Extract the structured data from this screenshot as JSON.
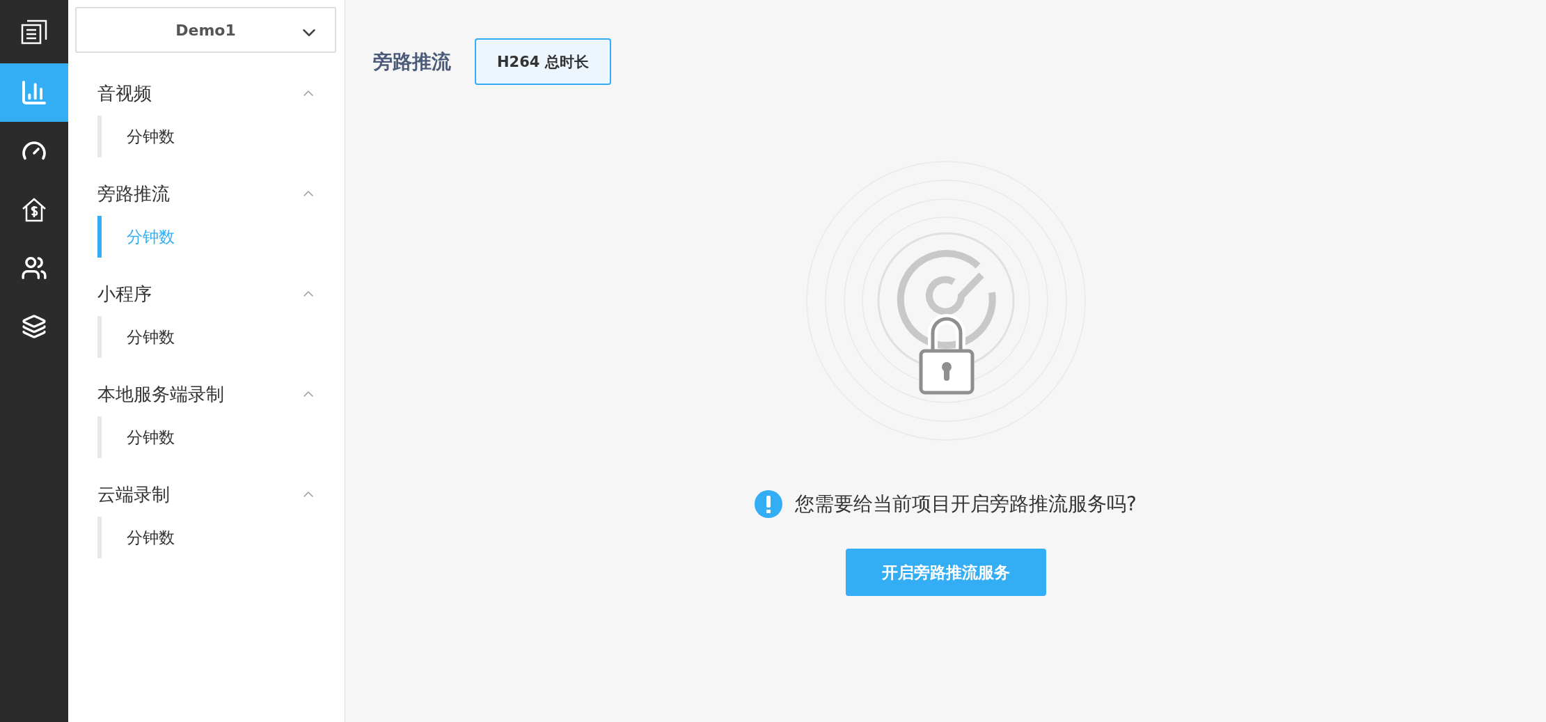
{
  "rail": [
    {
      "kind": "docs",
      "selected": false
    },
    {
      "kind": "chart",
      "selected": true
    },
    {
      "kind": "gauge",
      "selected": false
    },
    {
      "kind": "billing",
      "selected": false
    },
    {
      "kind": "users",
      "selected": false
    },
    {
      "kind": "layers",
      "selected": false
    }
  ],
  "project_select": {
    "value": "Demo1"
  },
  "sections": [
    {
      "title": "音视频",
      "expanded": true,
      "items": [
        {
          "label": "分钟数",
          "selected": false
        }
      ]
    },
    {
      "title": "旁路推流",
      "expanded": true,
      "items": [
        {
          "label": "分钟数",
          "selected": true
        }
      ]
    },
    {
      "title": "小程序",
      "expanded": true,
      "items": [
        {
          "label": "分钟数",
          "selected": false
        }
      ]
    },
    {
      "title": "本地服务端录制",
      "expanded": true,
      "items": [
        {
          "label": "分钟数",
          "selected": false
        }
      ]
    },
    {
      "title": "云端录制",
      "expanded": true,
      "items": [
        {
          "label": "分钟数",
          "selected": false
        }
      ]
    }
  ],
  "main": {
    "title": "旁路推流",
    "tabs": [
      {
        "label": "H264 总时长",
        "selected": true
      }
    ],
    "message": "您需要给当前项目开启旁路推流服务吗?",
    "action": "开启旁路推流服务"
  }
}
